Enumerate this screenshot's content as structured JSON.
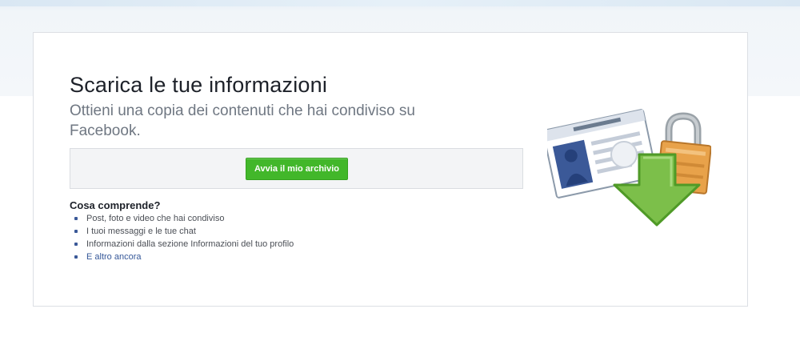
{
  "page": {
    "title": "Scarica le tue informazioni",
    "subtitle": "Ottieni una copia dei contenuti che hai condiviso su Facebook."
  },
  "action": {
    "button_label": "Avvia il mio archivio"
  },
  "includes": {
    "heading": "Cosa comprende?",
    "items": [
      "Post, foto e video che hai condiviso",
      "I tuoi messaggi e le tue chat",
      "Informazioni dalla sezione Informazioni del tuo profilo",
      "E altro ancora"
    ]
  },
  "illustration": {
    "icons": [
      "profile-card-icon",
      "padlock-icon",
      "download-arrow-icon"
    ],
    "colors": {
      "arrow_green": "#7cbf4a",
      "padlock_orange": "#e8a24a",
      "card_blue": "#3b5998",
      "button_green": "#42b72a",
      "link_blue": "#365899"
    }
  }
}
